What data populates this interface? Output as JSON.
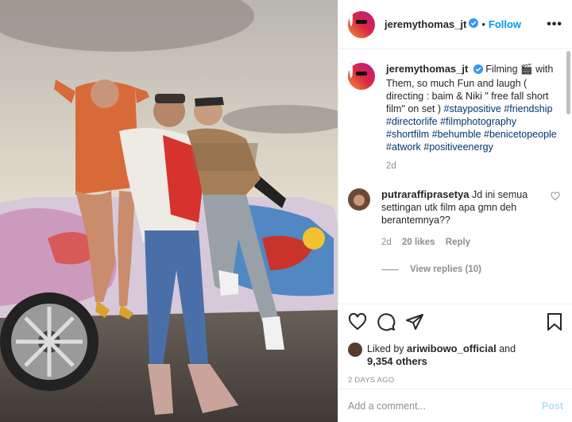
{
  "post": {
    "author": "jeremythomas_jt",
    "follow_label": "Follow",
    "dot": "•",
    "more_label": "•••",
    "caption": {
      "text_before": "Filming 🎬 with Them, so much Fun and laugh ( directing : baim & Niki \" free fall short film\" on set ) ",
      "hashtags": [
        "#staypositive",
        "#friendship",
        "#directorlife",
        "#filmphotography",
        "#shortfilm",
        "#behumble",
        "#benicetopeople",
        "#atwork",
        "#positiveenergy"
      ],
      "time": "2d"
    },
    "comments": [
      {
        "username": "putraraffiprasetya",
        "text": "Jd ini semua settingan utk film apa gmn deh berantemnya??",
        "time": "2d",
        "likes": "20 likes",
        "reply": "Reply",
        "view_replies": "View replies (10)"
      }
    ],
    "liked_by": {
      "prefix": "Liked by",
      "user": "ariwibowo_official",
      "and": "and",
      "others": "9,354 others"
    },
    "posted_ago": "2 DAYS AGO",
    "add_comment": {
      "placeholder": "Add a comment...",
      "post_label": "Post"
    }
  },
  "colors": {
    "accent": "#0095f6",
    "hashtag": "#00376b",
    "muted": "#8e8e8e",
    "post_disabled": "#b2dffc",
    "verified": "#3897f0"
  },
  "icons": [
    "verified-badge-icon",
    "more-options-icon",
    "heart-icon",
    "comment-icon",
    "share-icon",
    "bookmark-icon"
  ]
}
